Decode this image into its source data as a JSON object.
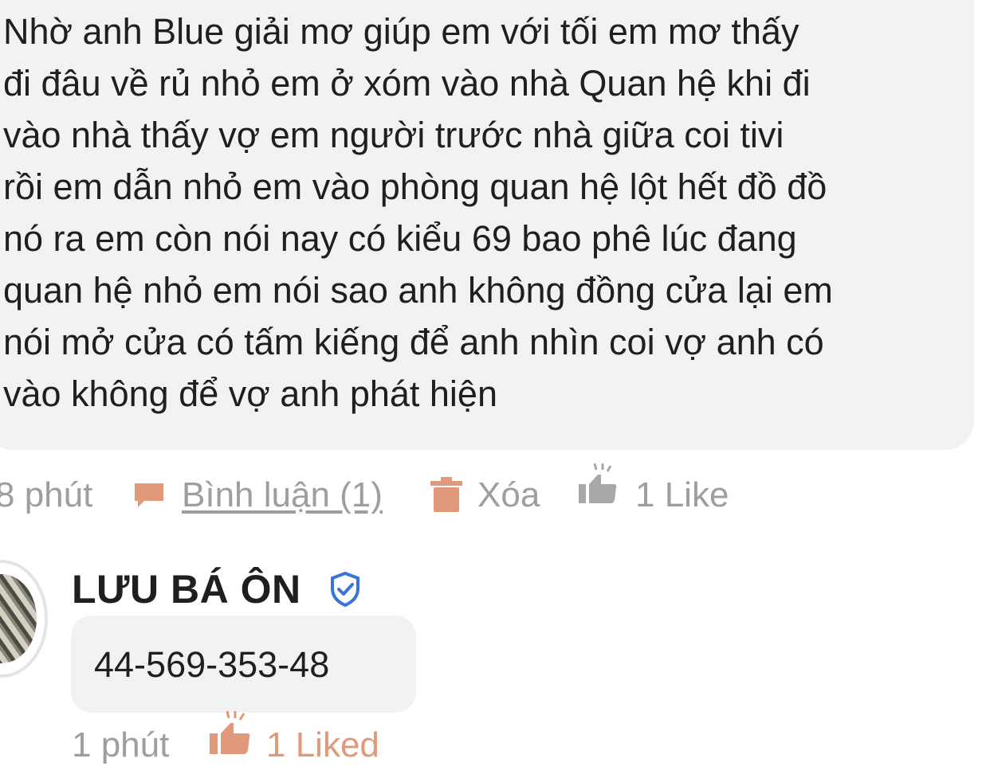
{
  "comment": {
    "lines": [
      "Nhờ anh Blue giải mơ giúp em với tối em mơ thấy",
      "đi đâu về rủ nhỏ em ở xóm vào nhà Quan hệ khi đi",
      "vào nhà thấy vợ em người trước nhà giữa coi tivi",
      "rồi em dẫn nhỏ em vào phòng quan hệ lột hết đồ đồ",
      "nó ra em còn nói nay có kiểu 69 bao phê lúc đang",
      "quan hệ nhỏ em nói sao anh không đồng cửa lại em",
      "nói mở cửa có tấm kiếng để anh nhìn coi vợ anh có",
      "vào không để vợ anh phát hiện"
    ],
    "time": "8 phút",
    "reply_link": "Bình luận (1)",
    "delete_label": "Xóa",
    "like_label": "1 Like"
  },
  "reply": {
    "author": "LƯU BÁ ÔN",
    "text": "44-569-353-48",
    "time": "1 phút",
    "like_label": "1 Liked"
  },
  "icons": {
    "comment": "speech-bubble-icon",
    "delete": "trash-icon",
    "like": "thumbs-up-icon",
    "verified": "verified-shield-icon",
    "liked": "thumbs-up-filled-icon"
  },
  "colors": {
    "bubble_bg": "#f2f2f2",
    "text": "#1f1f1f",
    "muted": "#9e9e9e",
    "accent": "#e0997b",
    "verified": "#3b73d9",
    "like_gray": "#a8a8a8"
  }
}
